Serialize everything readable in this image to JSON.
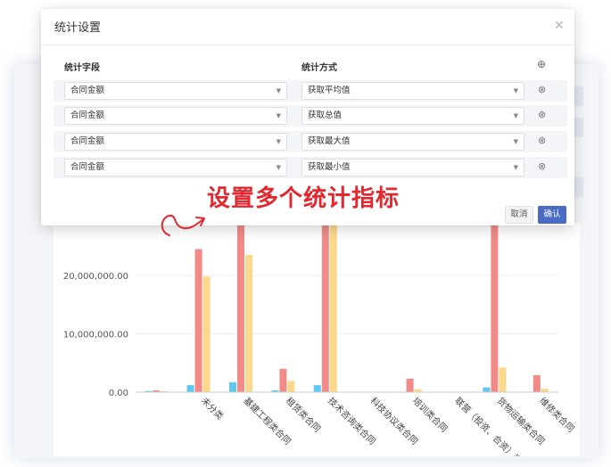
{
  "dialog": {
    "title": "统计设置",
    "close_icon": "close-icon",
    "field_header": "统计字段",
    "method_header": "统计方式",
    "add_icon": "plus-circle-icon",
    "rows": [
      {
        "field": "合同金额",
        "method": "获取平均值"
      },
      {
        "field": "合同金额",
        "method": "获取总值"
      },
      {
        "field": "合同金额",
        "method": "获取最大值"
      },
      {
        "field": "合同金额",
        "method": "获取最小值"
      }
    ],
    "cancel_label": "取消",
    "confirm_label": "确认"
  },
  "annotation": {
    "text": "设置多个统计指标",
    "color": "#e4262f"
  },
  "colors": {
    "series_red": "#f28b87",
    "series_yellow": "#fcd98a",
    "series_blue": "#5fc8f2",
    "primary_button": "#4a6bc4"
  },
  "chart_data": {
    "type": "bar",
    "categories": [
      "",
      "未分类",
      "基建工程类合同",
      "租赁类合同",
      "技术咨询类合同",
      "科技协议类合同",
      "培训类合同",
      "联营（投资、合资）类合同",
      "货物运输类合同",
      "维修类合同"
    ],
    "series": [
      {
        "color": "#5fc8f2",
        "values": [
          200000,
          1200000,
          1700000,
          300000,
          1200000,
          0,
          0,
          0,
          800000,
          0
        ]
      },
      {
        "color": "#f28b87",
        "values": [
          300000,
          24500000,
          40000000,
          4000000,
          40000000,
          0,
          2300000,
          0,
          40000000,
          2900000
        ]
      },
      {
        "color": "#fcd98a",
        "values": [
          150000,
          19800000,
          23500000,
          1900000,
          40000000,
          0,
          500000,
          0,
          4200000,
          600000
        ]
      }
    ],
    "yticks": [
      "0.00",
      "10,000,000.00",
      "20,000,000.00"
    ],
    "ylim": [
      0,
      29000000
    ]
  }
}
